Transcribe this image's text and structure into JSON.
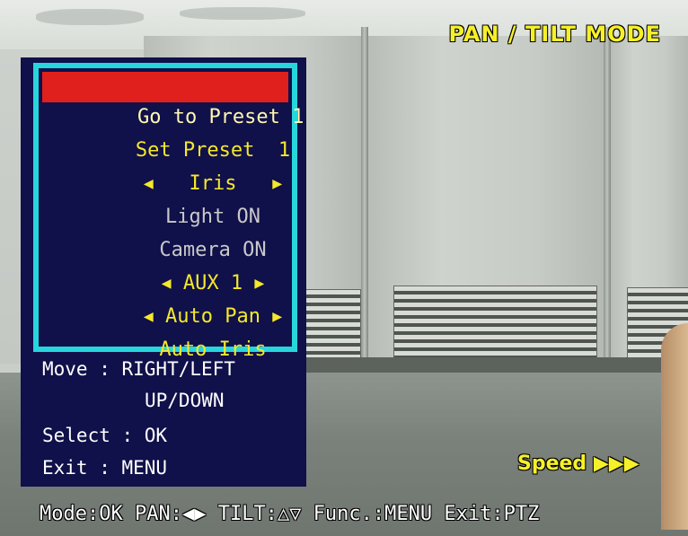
{
  "header": {
    "mode_title": "PAN / TILT MODE"
  },
  "menu": {
    "items": [
      {
        "label": "Go to Preset 1",
        "selected": true
      },
      {
        "label": "Set Preset  1"
      },
      {
        "label": "Iris",
        "arrows": true
      },
      {
        "label": "Light ON",
        "dim": true
      },
      {
        "label": "Camera ON",
        "dim": true
      },
      {
        "label": "AUX 1",
        "arrows": true
      },
      {
        "label": "Auto Pan",
        "arrows": true
      },
      {
        "label": "Auto Iris"
      }
    ],
    "help": {
      "move_line1": "Move : RIGHT/LEFT",
      "move_line2": "UP/DOWN",
      "select": "Select : OK",
      "exit": "Exit : MENU"
    }
  },
  "speed": {
    "label": "Speed",
    "indicator": "▶▶▶"
  },
  "status_bar": {
    "mode": "Mode:OK",
    "pan_label": "PAN:",
    "pan_arrows": "◀▶",
    "tilt_label": "TILT:",
    "tilt_arrows": "△▽",
    "func": "Func.:MENU",
    "exit": "Exit:PTZ"
  },
  "colors": {
    "menu_background": "#10104a",
    "menu_border": "#27d6dc",
    "selected_background": "#e0201d",
    "text_yellow": "#f4e82a"
  }
}
